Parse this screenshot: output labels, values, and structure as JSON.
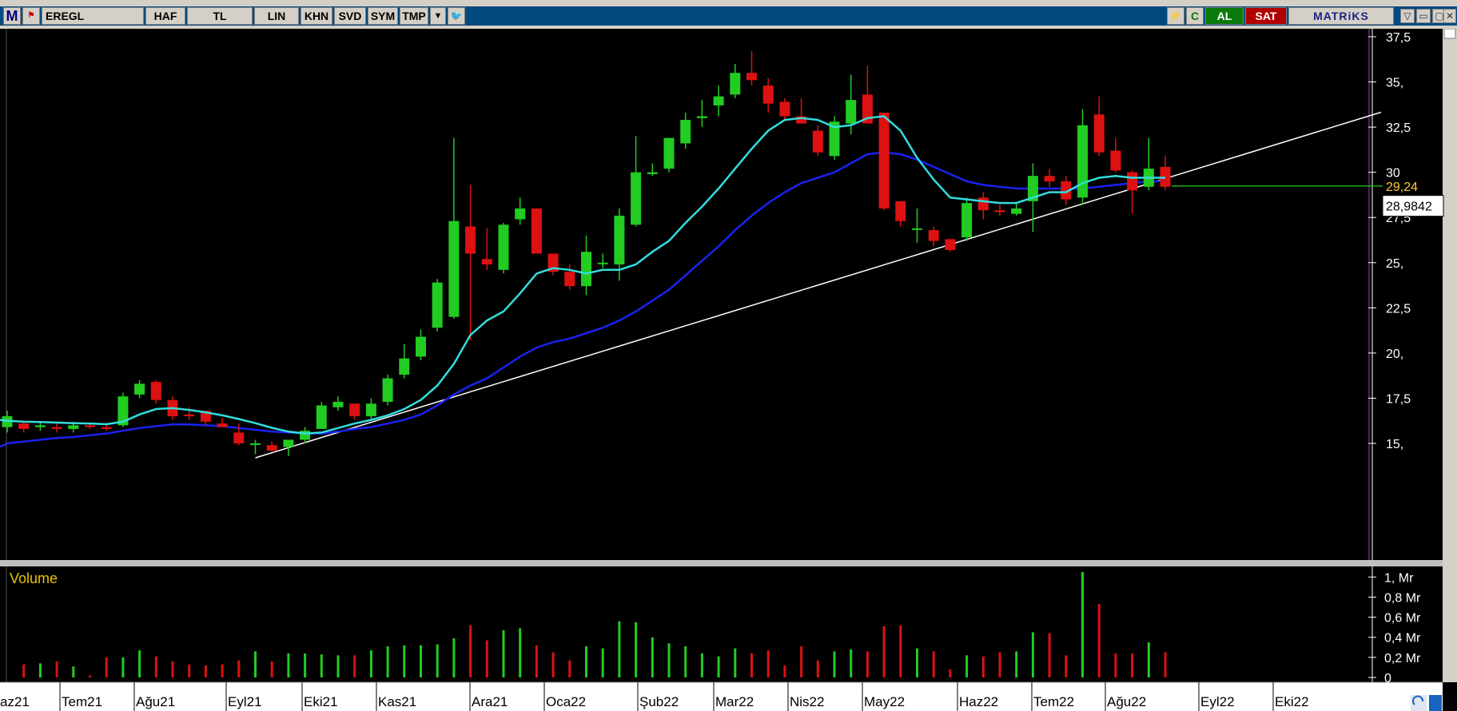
{
  "toolbar": {
    "logo": "M",
    "symbol": "EREGL",
    "buttons": [
      "HAF",
      "TL",
      "LIN",
      "KHN",
      "SVD",
      "SYM",
      "TMP"
    ],
    "al_label": "AL",
    "sat_label": "SAT",
    "brand": "MATRiKS",
    "refresh_label": "C"
  },
  "colors": {
    "up": "#22cc22",
    "down": "#dd1111",
    "ma_fast": "#33dddd",
    "ma_slow": "#1a22ee",
    "trendline": "#ffffff",
    "last_price": "#ffcc33"
  },
  "chart_data": [
    {
      "type": "candlestick",
      "symbol": "EREGL",
      "ylim": [
        13.2,
        38
      ],
      "y_ticks": [
        "37,5",
        "35,",
        "32,5",
        "30",
        "27,5",
        "25,",
        "22,5",
        "20,",
        "17,5",
        "15,"
      ],
      "last_price_label": "29,24",
      "crosshair_label": "28,9842",
      "date_labels": [
        "az21",
        "Tem21",
        "Ağu21",
        "Eyl21",
        "Eki21",
        "Kas21",
        "Ara21",
        "Oca22",
        "Şub22",
        "Mar22",
        "Nis22",
        "May22",
        "Haz22",
        "Tem22",
        "Ağu22",
        "Eyl22",
        "Eki22"
      ],
      "candles": [
        [
          15.9,
          16.8,
          15.6,
          16.5
        ],
        [
          16.1,
          16.2,
          15.6,
          15.8
        ],
        [
          15.9,
          16.2,
          15.7,
          16.0
        ],
        [
          15.9,
          16.2,
          15.6,
          15.8
        ],
        [
          15.8,
          16.2,
          15.6,
          16.0
        ],
        [
          16.0,
          16.1,
          15.8,
          15.9
        ],
        [
          15.9,
          16.1,
          15.7,
          15.8
        ],
        [
          16.0,
          17.8,
          15.9,
          17.6
        ],
        [
          17.7,
          18.5,
          17.5,
          18.3
        ],
        [
          18.4,
          18.5,
          17.2,
          17.4
        ],
        [
          17.4,
          17.6,
          16.3,
          16.5
        ],
        [
          16.6,
          17.0,
          16.3,
          16.5
        ],
        [
          16.8,
          16.8,
          16.0,
          16.2
        ],
        [
          16.1,
          16.4,
          15.9,
          15.9
        ],
        [
          15.6,
          16.1,
          14.9,
          15.0
        ],
        [
          15.0,
          15.2,
          14.4,
          15.0
        ],
        [
          14.9,
          15.1,
          14.5,
          14.6
        ],
        [
          14.8,
          15.2,
          14.3,
          15.2
        ],
        [
          15.2,
          15.9,
          15.0,
          15.7
        ],
        [
          15.8,
          17.3,
          15.8,
          17.1
        ],
        [
          17.0,
          17.6,
          16.8,
          17.3
        ],
        [
          17.2,
          17.2,
          16.3,
          16.5
        ],
        [
          16.5,
          17.5,
          16.3,
          17.2
        ],
        [
          17.3,
          18.8,
          17.1,
          18.6
        ],
        [
          18.8,
          20.5,
          18.6,
          19.7
        ],
        [
          19.8,
          21.3,
          19.6,
          20.9
        ],
        [
          21.4,
          24.1,
          21.2,
          23.9
        ],
        [
          22.0,
          31.9,
          21.9,
          27.3
        ],
        [
          27.0,
          29.3,
          20.7,
          25.5
        ],
        [
          25.2,
          26.9,
          24.6,
          24.9
        ],
        [
          24.6,
          27.2,
          24.4,
          27.1
        ],
        [
          27.4,
          28.6,
          27.1,
          28.0
        ],
        [
          28.0,
          28.0,
          25.5,
          25.5
        ],
        [
          25.5,
          25.5,
          24.3,
          24.5
        ],
        [
          24.5,
          24.9,
          23.5,
          23.7
        ],
        [
          23.7,
          26.5,
          23.2,
          25.6
        ],
        [
          25.0,
          25.5,
          24.7,
          25.0
        ],
        [
          24.9,
          28.0,
          24.0,
          27.6
        ],
        [
          27.1,
          32.0,
          27.0,
          30.0
        ],
        [
          29.9,
          30.5,
          29.8,
          30.0
        ],
        [
          30.2,
          31.9,
          30.0,
          31.9
        ],
        [
          31.6,
          33.3,
          31.3,
          32.9
        ],
        [
          33.0,
          34.0,
          32.5,
          33.1
        ],
        [
          33.7,
          34.8,
          33.1,
          34.2
        ],
        [
          34.3,
          36.0,
          34.1,
          35.5
        ],
        [
          35.5,
          36.7,
          34.8,
          35.1
        ],
        [
          34.8,
          35.2,
          33.3,
          33.8
        ],
        [
          33.9,
          34.1,
          32.9,
          33.1
        ],
        [
          33.1,
          34.1,
          32.7,
          32.7
        ],
        [
          32.3,
          32.6,
          30.9,
          31.1
        ],
        [
          30.9,
          33.1,
          30.7,
          32.8
        ],
        [
          32.7,
          35.4,
          32.1,
          34.0
        ],
        [
          34.3,
          35.9,
          32.8,
          32.7
        ],
        [
          33.3,
          33.3,
          27.9,
          28.0
        ],
        [
          28.4,
          28.4,
          27.0,
          27.3
        ],
        [
          26.9,
          28.0,
          26.1,
          26.9
        ],
        [
          26.8,
          27.0,
          25.9,
          26.2
        ],
        [
          26.3,
          26.3,
          25.6,
          25.7
        ],
        [
          26.4,
          28.6,
          26.2,
          28.3
        ],
        [
          28.6,
          28.9,
          27.4,
          27.9
        ],
        [
          27.9,
          28.2,
          27.6,
          27.8
        ],
        [
          27.7,
          28.3,
          27.6,
          28.0
        ],
        [
          28.4,
          30.5,
          26.7,
          29.8
        ],
        [
          29.8,
          30.2,
          29.2,
          29.5
        ],
        [
          29.5,
          29.8,
          28.2,
          28.5
        ],
        [
          28.6,
          33.5,
          28.2,
          32.6
        ],
        [
          33.2,
          34.2,
          30.9,
          31.1
        ],
        [
          31.2,
          31.9,
          30.0,
          30.1
        ],
        [
          30.0,
          30.1,
          27.7,
          29.0
        ],
        [
          29.2,
          31.9,
          29.0,
          30.2
        ],
        [
          30.3,
          30.9,
          29.0,
          29.2
        ]
      ],
      "ma_fast": [
        16.25,
        16.2,
        16.18,
        16.15,
        16.12,
        16.1,
        16.06,
        16.2,
        16.6,
        16.9,
        16.95,
        16.85,
        16.72,
        16.55,
        16.35,
        16.12,
        15.86,
        15.65,
        15.55,
        15.6,
        15.85,
        16.1,
        16.3,
        16.55,
        16.9,
        17.4,
        18.2,
        19.4,
        21.0,
        21.8,
        22.3,
        23.3,
        24.4,
        24.7,
        24.6,
        24.4,
        24.6,
        24.6,
        24.9,
        25.6,
        26.2,
        27.2,
        28.1,
        29.1,
        30.2,
        31.3,
        32.3,
        32.9,
        33.0,
        32.9,
        32.5,
        32.6,
        33.0,
        33.1,
        32.3,
        30.8,
        29.6,
        28.6,
        28.5,
        28.4,
        28.3,
        28.3,
        28.6,
        28.9,
        28.9,
        29.4,
        29.7,
        29.8,
        29.7,
        29.7,
        29.7
      ],
      "ma_slow": [
        15.0,
        15.1,
        15.2,
        15.3,
        15.35,
        15.45,
        15.55,
        15.7,
        15.85,
        15.95,
        16.05,
        16.05,
        16.0,
        15.95,
        15.85,
        15.75,
        15.65,
        15.6,
        15.55,
        15.55,
        15.65,
        15.8,
        15.9,
        16.1,
        16.3,
        16.6,
        17.1,
        17.7,
        18.2,
        18.6,
        19.2,
        19.8,
        20.3,
        20.6,
        20.8,
        21.1,
        21.4,
        21.8,
        22.3,
        22.9,
        23.5,
        24.3,
        25.1,
        25.9,
        26.8,
        27.6,
        28.3,
        28.9,
        29.4,
        29.7,
        30.0,
        30.5,
        31.0,
        31.1,
        31.0,
        30.7,
        30.3,
        29.9,
        29.5,
        29.3,
        29.2,
        29.1,
        29.1,
        29.1,
        29.1,
        29.1,
        29.2,
        29.3,
        29.4,
        29.5,
        29.5
      ],
      "trendline": {
        "from": [
          15,
          14.2
        ],
        "to": [
          73,
          30.5
        ]
      }
    },
    {
      "type": "bar",
      "title": "Volume",
      "ylim": [
        0,
        1.05
      ],
      "y_ticks": [
        "1, Mr",
        "0,8 Mr",
        "0,6 Mr",
        "0,4 Mr",
        "0,2 Mr",
        "0"
      ],
      "values": [
        0.13,
        0.14,
        0.16,
        0.11,
        0.02,
        0.2,
        0.2,
        0.27,
        0.21,
        0.16,
        0.13,
        0.12,
        0.13,
        0.17,
        0.26,
        0.16,
        0.24,
        0.24,
        0.23,
        0.22,
        0.22,
        0.27,
        0.31,
        0.32,
        0.32,
        0.33,
        0.39,
        0.52,
        0.37,
        0.47,
        0.49,
        0.32,
        0.25,
        0.17,
        0.31,
        0.29,
        0.56,
        0.55,
        0.4,
        0.34,
        0.31,
        0.24,
        0.21,
        0.29,
        0.24,
        0.27,
        0.12,
        0.31,
        0.17,
        0.26,
        0.28,
        0.26,
        0.51,
        0.52,
        0.29,
        0.26,
        0.08,
        0.22,
        0.21,
        0.25,
        0.26,
        0.45,
        0.44,
        0.22,
        1.05,
        0.73,
        0.24,
        0.24,
        0.35,
        0.25
      ]
    }
  ]
}
